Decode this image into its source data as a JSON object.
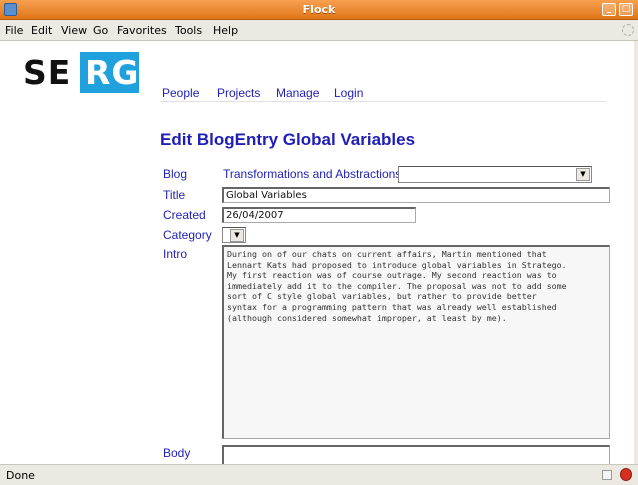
{
  "window": {
    "title": "Flock"
  },
  "menu": [
    "File",
    "Edit",
    "View",
    "Go",
    "Favorites",
    "Tools",
    "Help"
  ],
  "logo": {
    "left_text": "SE",
    "right_text": "RG",
    "accent": "#1ea1dc"
  },
  "nav": [
    "People",
    "Projects",
    "Manage",
    "Login"
  ],
  "page": {
    "title": "Edit BlogEntry Global Variables"
  },
  "form": {
    "blog_label": "Blog",
    "blog_value": "Transformations and Abstractions",
    "title_label": "Title",
    "title_value": "Global Variables",
    "created_label": "Created",
    "created_value": "26/04/2007",
    "category_label": "Category",
    "intro_label": "Intro",
    "intro_value": "During on of our chats on current affairs, Martin mentioned that\nLennart Kats had proposed to introduce global variables in Stratego.\nMy first reaction was of course outrage. My second reaction was to\nimmediately add it to the compiler. The proposal was not to add some\nsort of C style global variables, but rather to provide better\nsyntax for a programming pattern that was already well established\n(although considered somewhat improper, at least by me).",
    "body_label": "Body"
  },
  "status": {
    "text": "Done"
  },
  "colors": {
    "titlebar": "#e07518",
    "link": "#1f1fb8"
  }
}
